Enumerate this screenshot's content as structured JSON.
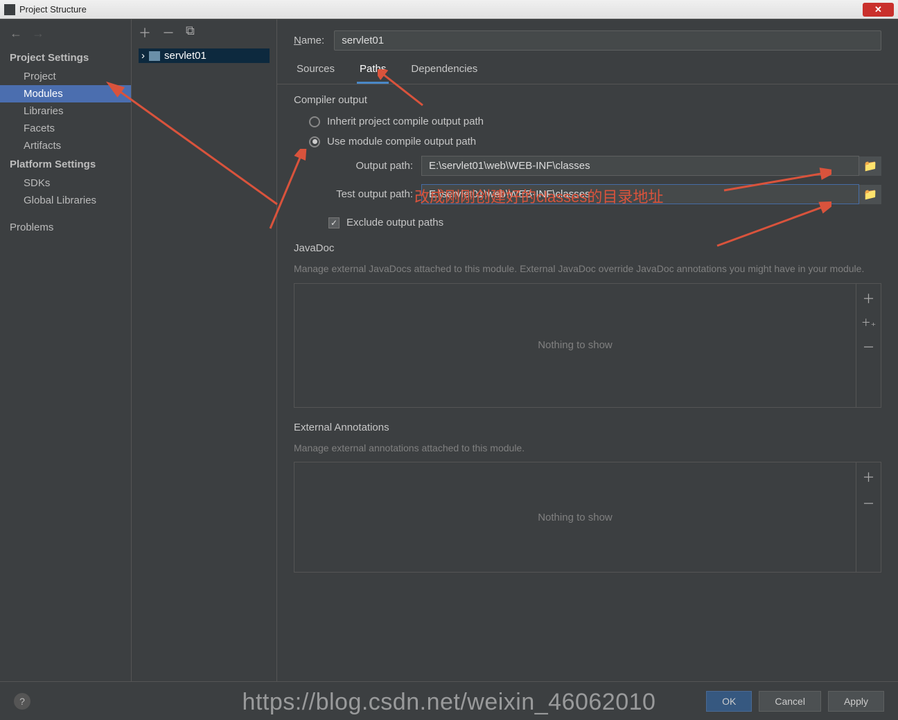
{
  "window": {
    "title": "Project Structure"
  },
  "sidebar": {
    "projectSettings": "Project Settings",
    "items": [
      "Project",
      "Modules",
      "Libraries",
      "Facets",
      "Artifacts"
    ],
    "platformSettings": "Platform Settings",
    "platformItems": [
      "SDKs",
      "Global Libraries"
    ],
    "problems": "Problems"
  },
  "tree": {
    "root": "servlet01"
  },
  "form": {
    "nameLabel": "Name:",
    "nameValue": "servlet01"
  },
  "tabs": [
    "Sources",
    "Paths",
    "Dependencies"
  ],
  "compiler": {
    "title": "Compiler output",
    "inheritLabel": "Inherit project compile output path",
    "useModuleLabel": "Use module compile output path",
    "outputPathLabel": "Output path:",
    "outputPath": "E:\\servlet01\\web\\WEB-INF\\classes",
    "testOutputLabel": "Test output path:",
    "testOutputPath": "E:\\servlet01\\web\\WEB-INF\\classes",
    "excludeLabel": "Exclude output paths"
  },
  "javadoc": {
    "title": "JavaDoc",
    "desc": "Manage external JavaDocs attached to this module. External JavaDoc override JavaDoc annotations you might have in your module.",
    "empty": "Nothing to show"
  },
  "extAnnot": {
    "title": "External Annotations",
    "desc": "Manage external annotations attached to this module.",
    "empty": "Nothing to show"
  },
  "footer": {
    "ok": "OK",
    "cancel": "Cancel",
    "apply": "Apply"
  },
  "annotation": {
    "text": "改成刚刚创建好的classes的目录地址"
  },
  "watermark": "https://blog.csdn.net/weixin_46062010"
}
